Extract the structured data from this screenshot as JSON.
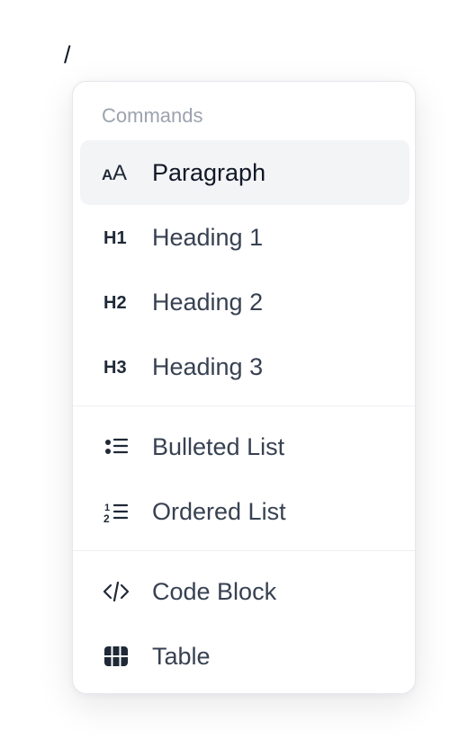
{
  "editor": {
    "trigger_text": "/"
  },
  "menu": {
    "header": "Commands",
    "items": [
      {
        "label": "Paragraph",
        "icon": "paragraph-icon",
        "active": true
      },
      {
        "label": "Heading 1",
        "icon": "heading-1-icon",
        "active": false
      },
      {
        "label": "Heading 2",
        "icon": "heading-2-icon",
        "active": false
      },
      {
        "label": "Heading 3",
        "icon": "heading-3-icon",
        "active": false
      },
      {
        "label": "Bulleted List",
        "icon": "bulleted-list-icon",
        "active": false
      },
      {
        "label": "Ordered List",
        "icon": "ordered-list-icon",
        "active": false
      },
      {
        "label": "Code Block",
        "icon": "code-block-icon",
        "active": false
      },
      {
        "label": "Table",
        "icon": "table-icon",
        "active": false
      }
    ],
    "icon_glyphs": {
      "heading_1": "H1",
      "heading_2": "H2",
      "heading_3": "H3",
      "ordered_1": "1",
      "ordered_2": "2"
    }
  },
  "colors": {
    "active_background": "#f3f4f6",
    "icon": "#1f2937",
    "label": "#374151",
    "header": "#9ca3af",
    "border": "#e5e7eb"
  }
}
